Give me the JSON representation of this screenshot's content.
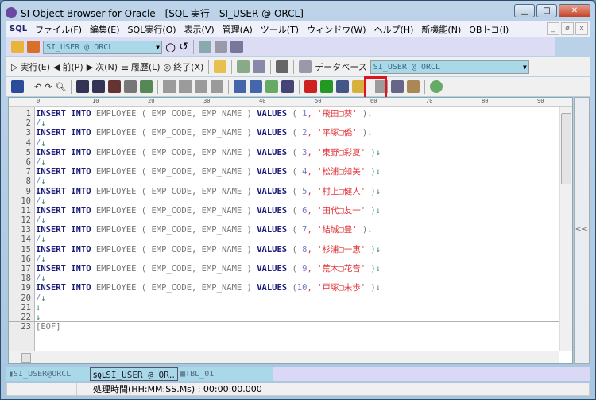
{
  "window": {
    "title": "SI Object Browser for Oracle - [SQL 実行 - SI_USER @ ORCL]"
  },
  "menu": [
    "ファイル(F)",
    "編集(E)",
    "SQL実行(O)",
    "表示(V)",
    "管理(A)",
    "ツール(T)",
    "ウィンドウ(W)",
    "ヘルプ(H)",
    "新機能(N)",
    "OBトコ(I)"
  ],
  "toolbar1": {
    "connection": "SI_USER @ ORCL"
  },
  "toolbar2": {
    "run": "実行(E)",
    "prev": "前(P)",
    "next": "次(N)",
    "history": "履歴(L)",
    "end": "終了(X)",
    "database_label": "データベース",
    "database": "SI_USER @ ORCL"
  },
  "ruler": [
    "0",
    "10",
    "20",
    "30",
    "40",
    "50",
    "60",
    "70",
    "80",
    "90"
  ],
  "editor": {
    "lines": [
      {
        "n": "1",
        "t": "ins",
        "v": "1",
        "s": "飛田□葵"
      },
      {
        "n": "2",
        "t": "sl"
      },
      {
        "n": "3",
        "t": "ins",
        "v": "2",
        "s": "平塚□僑"
      },
      {
        "n": "4",
        "t": "sl"
      },
      {
        "n": "5",
        "t": "ins",
        "v": "3",
        "s": "東野□彩夏"
      },
      {
        "n": "6",
        "t": "sl"
      },
      {
        "n": "7",
        "t": "ins",
        "v": "4",
        "s": "松浦□知美"
      },
      {
        "n": "8",
        "t": "sl"
      },
      {
        "n": "9",
        "t": "ins",
        "v": "5",
        "s": "村上□健人"
      },
      {
        "n": "10",
        "t": "sl"
      },
      {
        "n": "11",
        "t": "ins",
        "v": "6",
        "s": "田代□友一"
      },
      {
        "n": "12",
        "t": "sl"
      },
      {
        "n": "13",
        "t": "ins",
        "v": "7",
        "s": "結城□豊"
      },
      {
        "n": "14",
        "t": "sl"
      },
      {
        "n": "15",
        "t": "ins",
        "v": "8",
        "s": "杉浦□一恵"
      },
      {
        "n": "16",
        "t": "sl"
      },
      {
        "n": "17",
        "t": "ins",
        "v": "9",
        "s": "荒木□花音"
      },
      {
        "n": "18",
        "t": "sl"
      },
      {
        "n": "19",
        "t": "ins",
        "v": "10",
        "s": "戸塚□未歩"
      },
      {
        "n": "20",
        "t": "sl"
      },
      {
        "n": "21",
        "t": "nl"
      },
      {
        "n": "22",
        "t": "nl"
      },
      {
        "n": "23",
        "t": "eof"
      }
    ],
    "tokens": {
      "insert": "INSERT",
      "into": "INTO",
      "table": "EMPLOYEE",
      "cols": "( EMP_CODE, EMP_NAME )",
      "values": "VALUES",
      "slash": "/",
      "newline": "↓",
      "eof": "[EOF]"
    }
  },
  "side": {
    "collapse": "<<"
  },
  "tabs": [
    {
      "label": "SI_USER@ORCL"
    },
    {
      "label": "SI_USER @ OR‥"
    },
    {
      "label": "TBL_01"
    }
  ],
  "status": {
    "time": "処理時間(HH:MM:SS.Ms) : 00:00:00.000"
  }
}
